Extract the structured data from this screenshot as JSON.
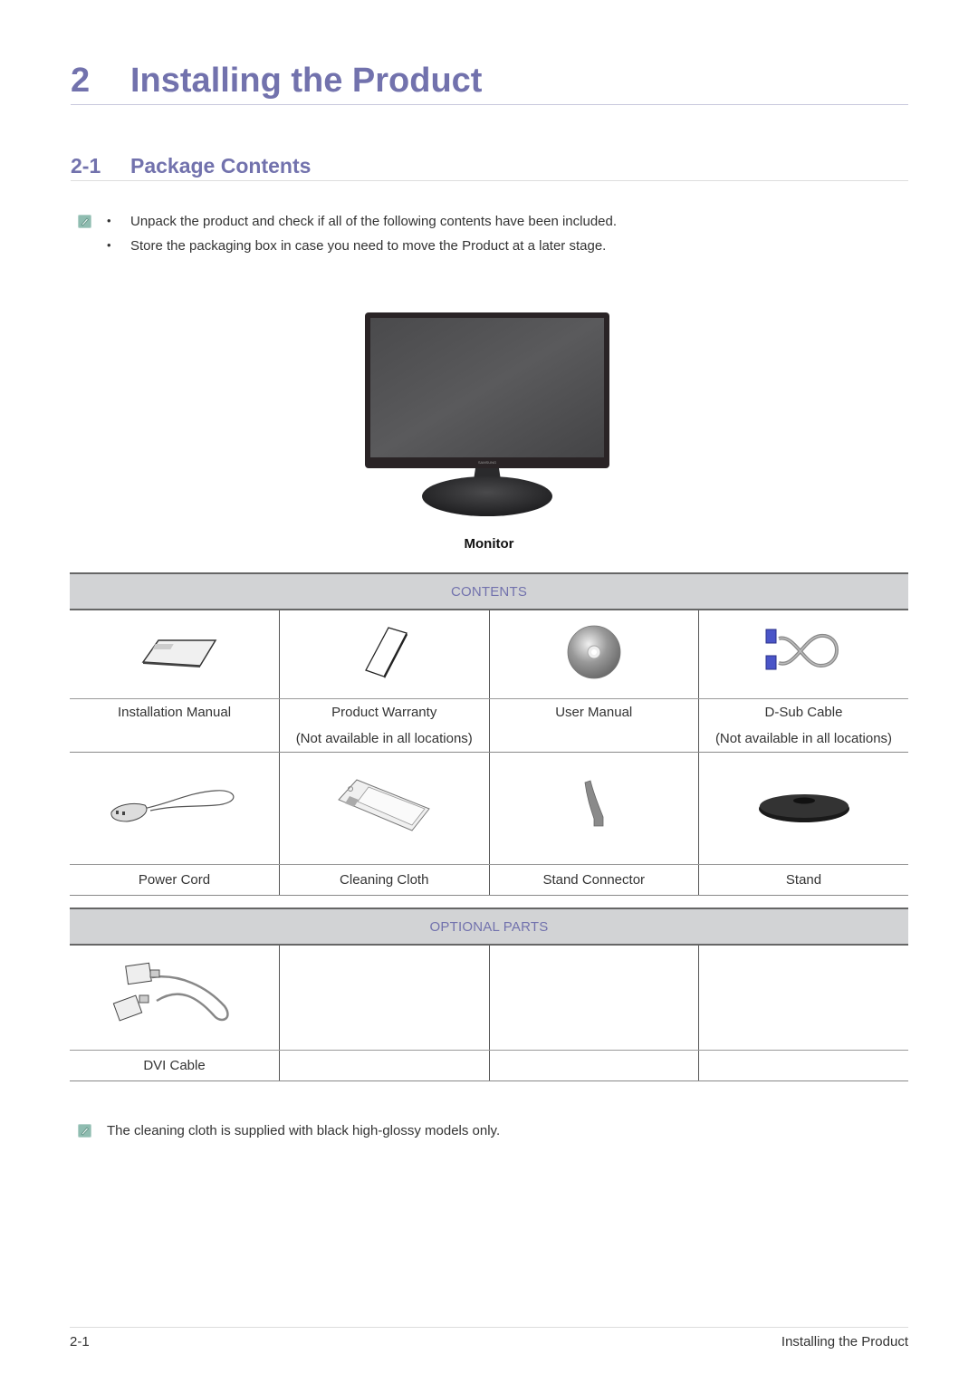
{
  "chapter": {
    "number": "2",
    "title": "Installing the Product"
  },
  "section": {
    "number": "2-1",
    "title": "Package Contents"
  },
  "intro_bullets": [
    "Unpack the product and check if all of the following contents have been included.",
    "Store the packaging box in case you need to move the Product at a later stage."
  ],
  "bullet_symbol": "•",
  "monitor": {
    "label": "Monitor",
    "brand": "SAMSUNG"
  },
  "contents_table": {
    "header": "CONTENTS",
    "rows": [
      [
        {
          "icon": "installation-manual-icon",
          "label": "Installation Manual",
          "note": ""
        },
        {
          "icon": "product-warranty-icon",
          "label": "Product Warranty",
          "note": "(Not available in all locations)"
        },
        {
          "icon": "user-manual-cd-icon",
          "label": "User Manual",
          "note": ""
        },
        {
          "icon": "d-sub-cable-icon",
          "label": "D-Sub Cable",
          "note": "(Not available in all locations)"
        }
      ],
      [
        {
          "icon": "power-cord-icon",
          "label": "Power Cord",
          "note": ""
        },
        {
          "icon": "cleaning-cloth-icon",
          "label": "Cleaning Cloth",
          "note": ""
        },
        {
          "icon": "stand-connector-icon",
          "label": "Stand Connector",
          "note": ""
        },
        {
          "icon": "stand-icon",
          "label": "Stand",
          "note": ""
        }
      ]
    ]
  },
  "optional_table": {
    "header": "OPTIONAL PARTS",
    "rows": [
      [
        {
          "icon": "dvi-cable-icon",
          "label": "DVI Cable",
          "note": ""
        },
        {
          "icon": "",
          "label": "",
          "note": ""
        },
        {
          "icon": "",
          "label": "",
          "note": ""
        },
        {
          "icon": "",
          "label": "",
          "note": ""
        }
      ]
    ]
  },
  "footnote": "The cleaning cloth is supplied with black high-glossy models only.",
  "footer": {
    "page": "2-1",
    "chapter_title": "Installing the Product"
  },
  "colors": {
    "heading": "#7272ad",
    "table_header_bg": "#d2d3d5",
    "note_icon": "#8fbcb0"
  }
}
